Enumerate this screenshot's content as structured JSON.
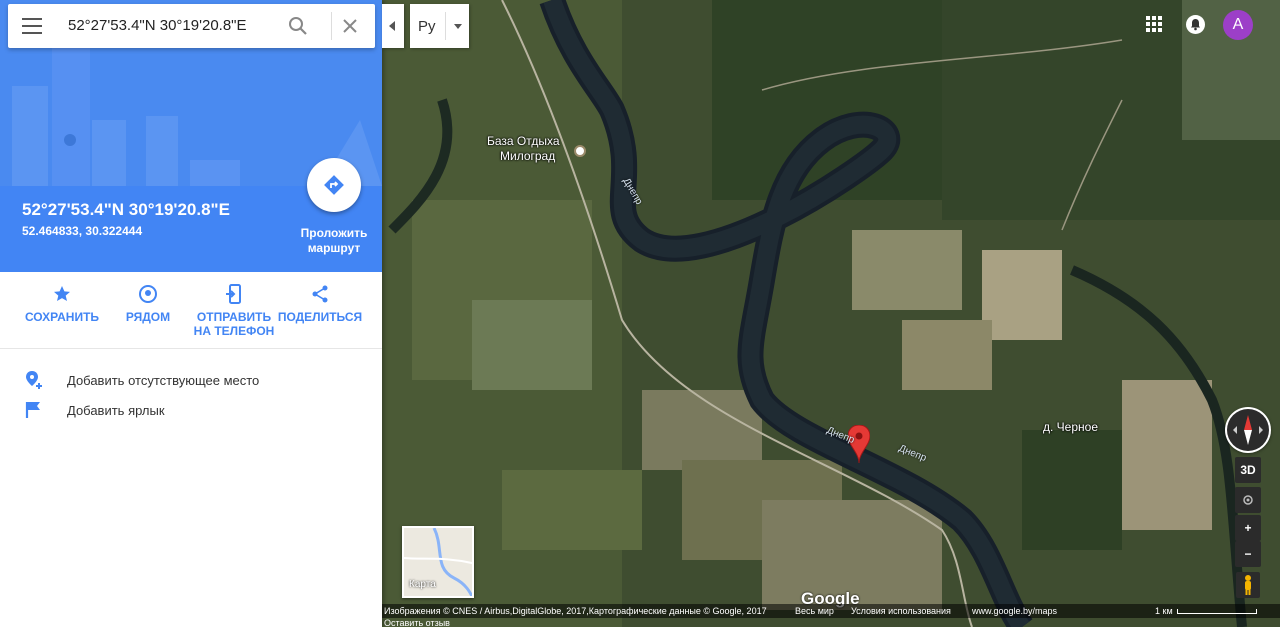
{
  "search": {
    "query": "52°27'53.4\"N 30°19'20.8\"E",
    "menu_icon": "menu-icon",
    "search_icon": "search-icon",
    "close_icon": "close-icon"
  },
  "language": {
    "label": "Ру"
  },
  "place": {
    "title": "52°27'53.4\"N 30°19'20.8\"E",
    "decimal": "52.464833, 30.322444"
  },
  "route": {
    "label_line1": "Проложить",
    "label_line2": "маршрут"
  },
  "actions": [
    {
      "icon": "star-icon",
      "line1": "СОХРАНИТЬ",
      "line2": ""
    },
    {
      "icon": "nearby-icon",
      "line1": "РЯДОМ",
      "line2": ""
    },
    {
      "icon": "send-to-phone-icon",
      "line1": "ОТПРАВИТЬ",
      "line2": "НА ТЕЛЕФОН"
    },
    {
      "icon": "share-icon",
      "line1": "ПОДЕЛИТЬСЯ",
      "line2": ""
    }
  ],
  "extras": [
    {
      "icon": "add-place-icon",
      "label": "Добавить отсутствующее место"
    },
    {
      "icon": "flag-icon",
      "label": "Добавить ярлык"
    }
  ],
  "header_right": {
    "avatar_letter": "A"
  },
  "map": {
    "labels": {
      "base_line1": "База Отдыха",
      "base_line2": "Милоград",
      "river1": "Днепр",
      "river2": "Днепр",
      "river3": "Днепр",
      "village": "д. Черное"
    },
    "controls": {
      "view3d": "3D",
      "zoom_in": "+",
      "zoom_out": "−"
    },
    "minimap_label": "Карта",
    "logo": "Google"
  },
  "footer": {
    "attribution": "Изображения © CNES / Airbus,DigitalGlobe, 2017,Картографические данные © Google, 2017",
    "world": "Весь мир",
    "terms": "Условия использования",
    "url": "www.google.by/maps",
    "scale": "1 км",
    "feedback": "Оставить отзыв"
  },
  "colors": {
    "accent": "#4285f4",
    "avatar": "#9c3fc8",
    "pin": "#e53935"
  }
}
